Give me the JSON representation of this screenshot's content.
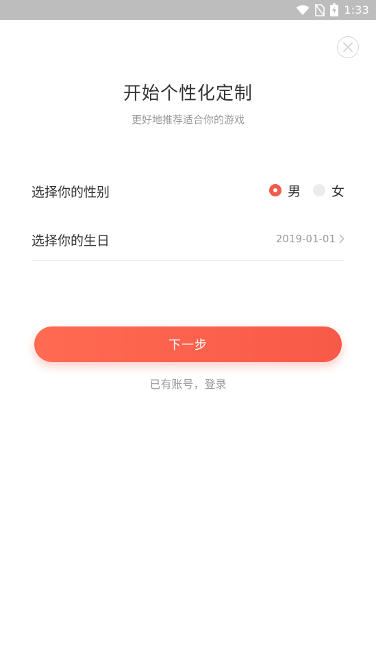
{
  "status_bar": {
    "time": "1:33",
    "icons": [
      "wifi-icon",
      "no-sim-icon",
      "battery-charging-icon"
    ]
  },
  "header": {
    "title": "开始个性化定制",
    "subtitle": "更好地推荐适合你的游戏"
  },
  "gender": {
    "label": "选择你的性别",
    "options": [
      {
        "label": "男",
        "selected": true
      },
      {
        "label": "女",
        "selected": false
      }
    ]
  },
  "birthday": {
    "label": "选择你的生日",
    "value": "2019-01-01"
  },
  "actions": {
    "next_label": "下一步",
    "login_label": "已有账号，登录"
  },
  "colors": {
    "accent": "#f85a48",
    "status_bar": "#bdbdbd",
    "text_primary": "#333333",
    "text_secondary": "#9a9a9a"
  }
}
